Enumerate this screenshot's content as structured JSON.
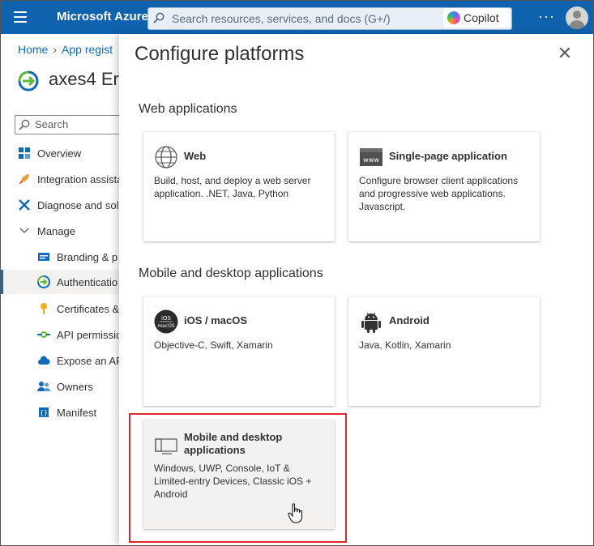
{
  "topbar": {
    "brand": "Microsoft Azure",
    "search_placeholder": "Search resources, services, and docs (G+/)",
    "copilot_label": "Copilot",
    "more_label": "···"
  },
  "left": {
    "breadcrumb": [
      "Home",
      "App regist"
    ],
    "app_name": "axes4 Er",
    "search_placeholder": "Search",
    "nav": [
      {
        "label": "Overview",
        "icon": "grid-icon"
      },
      {
        "label": "Integration assista",
        "icon": "rocket-icon"
      },
      {
        "label": "Diagnose and sol",
        "icon": "tools-icon"
      },
      {
        "label": "Manage",
        "icon": "chevron-down-icon"
      },
      {
        "label": "Branding & p",
        "icon": "branding-icon"
      },
      {
        "label": "Authenticatio",
        "icon": "auth-icon"
      },
      {
        "label": "Certificates &",
        "icon": "key-icon"
      },
      {
        "label": "API permissic",
        "icon": "api-icon"
      },
      {
        "label": "Expose an AP",
        "icon": "cloud-icon"
      },
      {
        "label": "Owners",
        "icon": "people-icon"
      },
      {
        "label": "Manifest",
        "icon": "manifest-icon"
      }
    ]
  },
  "panel": {
    "title": "Configure platforms",
    "close_label": "✕",
    "web_section": "Web applications",
    "mobile_section": "Mobile and desktop applications",
    "cards": {
      "web": {
        "title": "Web",
        "desc": "Build, host, and deploy a web server application. .NET, Java, Python"
      },
      "spa": {
        "title": "Single-page application",
        "desc": "Configure browser client applications and progressive web applications. Javascript.",
        "icon_text": "www"
      },
      "ios": {
        "title": "iOS / macOS",
        "desc": "Objective-C, Swift, Xamarin",
        "icon_text_1": "iOS",
        "icon_text_2": "macOS"
      },
      "android": {
        "title": "Android",
        "desc": "Java, Kotlin, Xamarin"
      },
      "desktop": {
        "title": "Mobile and desktop applications",
        "desc": "Windows, UWP, Console, IoT & Limited-entry Devices, Classic iOS + Android"
      }
    }
  },
  "colors": {
    "topbar": "#0f62ae",
    "accent": "#0f6cbd",
    "highlight": "#e0272e"
  }
}
